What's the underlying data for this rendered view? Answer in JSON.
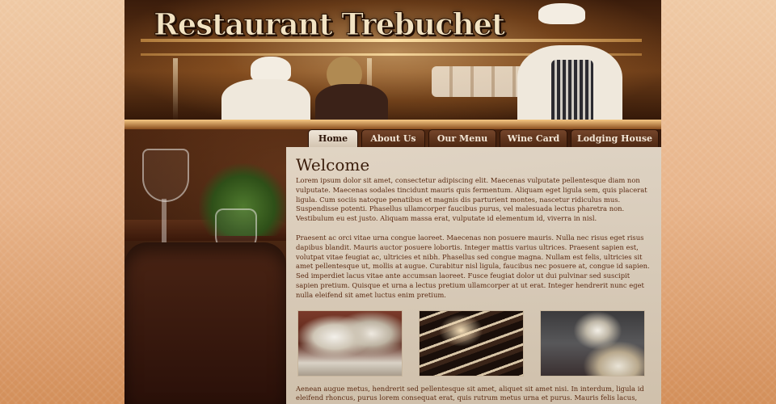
{
  "site": {
    "logo_text": "Restaurant Trebuchet"
  },
  "nav": {
    "items": [
      {
        "label": "Home",
        "active": true
      },
      {
        "label": "About Us",
        "active": false
      },
      {
        "label": "Our Menu",
        "active": false
      },
      {
        "label": "Wine Card",
        "active": false
      },
      {
        "label": "Lodging House",
        "active": false
      }
    ]
  },
  "main": {
    "heading": "Welcome",
    "paragraphs": [
      "Lorem ipsum dolor sit amet, consectetur adipiscing elit. Maecenas vulputate pellentesque diam non vulputate. Maecenas sodales tincidunt mauris quis fermentum. Aliquam eget ligula sem, quis placerat ligula. Cum sociis natoque penatibus et magnis dis parturient montes, nascetur ridiculus mus. Suspendisse potenti. Phasellus ullamcorper faucibus purus, vel malesuada lectus pharetra non. Vestibulum eu est justo. Aliquam massa erat, vulputate id elementum id, viverra in nisl.",
      "Praesent ac orci vitae urna congue laoreet. Maecenas non posuere mauris. Nulla nec risus eget risus dapibus blandit. Mauris auctor posuere lobortis. Integer mattis varius ultrices. Praesent sapien est, volutpat vitae feugiat ac, ultricies et nibh. Phasellus sed congue magna. Nullam est felis, ultricies sit amet pellentesque ut, mollis at augue. Curabitur nisl ligula, faucibus nec posuere at, congue id sapien. Sed imperdiet lacus vitae ante accumsan laoreet. Fusce feugiat dolor ut dui pulvinar sed suscipit sapien pretium. Quisque et urna a lectus pretium ullamcorper at ut erat. Integer hendrerit nunc eget nulla eleifend sit amet luctus enim pretium.",
      "Aenean augue metus, hendrerit sed pellentesque sit amet, aliquet sit amet nisi. In interdum, ligula id eleifend rhoncus, purus lorem consequat erat, quis rutrum metus urna et purus. Mauris felis lacus,"
    ]
  },
  "colors": {
    "accent_brown": "#4e2812",
    "active_tab": "#f0e6d8",
    "text_brown": "#5a2a12",
    "page_peach": "#e8b48a"
  }
}
